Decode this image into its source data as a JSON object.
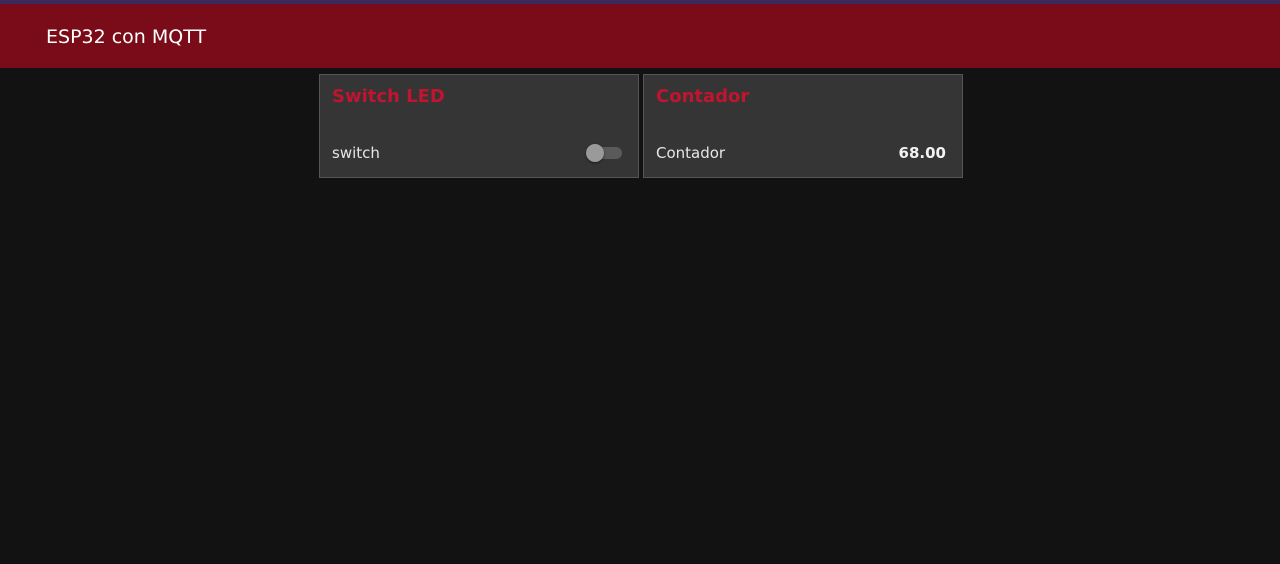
{
  "header": {
    "title": "ESP32 con MQTT"
  },
  "cards": {
    "switch_led": {
      "title": "Switch LED",
      "label": "switch",
      "toggle_on": false
    },
    "contador": {
      "title": "Contador",
      "label": "Contador",
      "value": "68.00"
    }
  },
  "colors": {
    "header_bg": "#7a0b19",
    "accent_title": "#c0142f",
    "page_bg": "#121212",
    "card_bg": "#353535"
  }
}
